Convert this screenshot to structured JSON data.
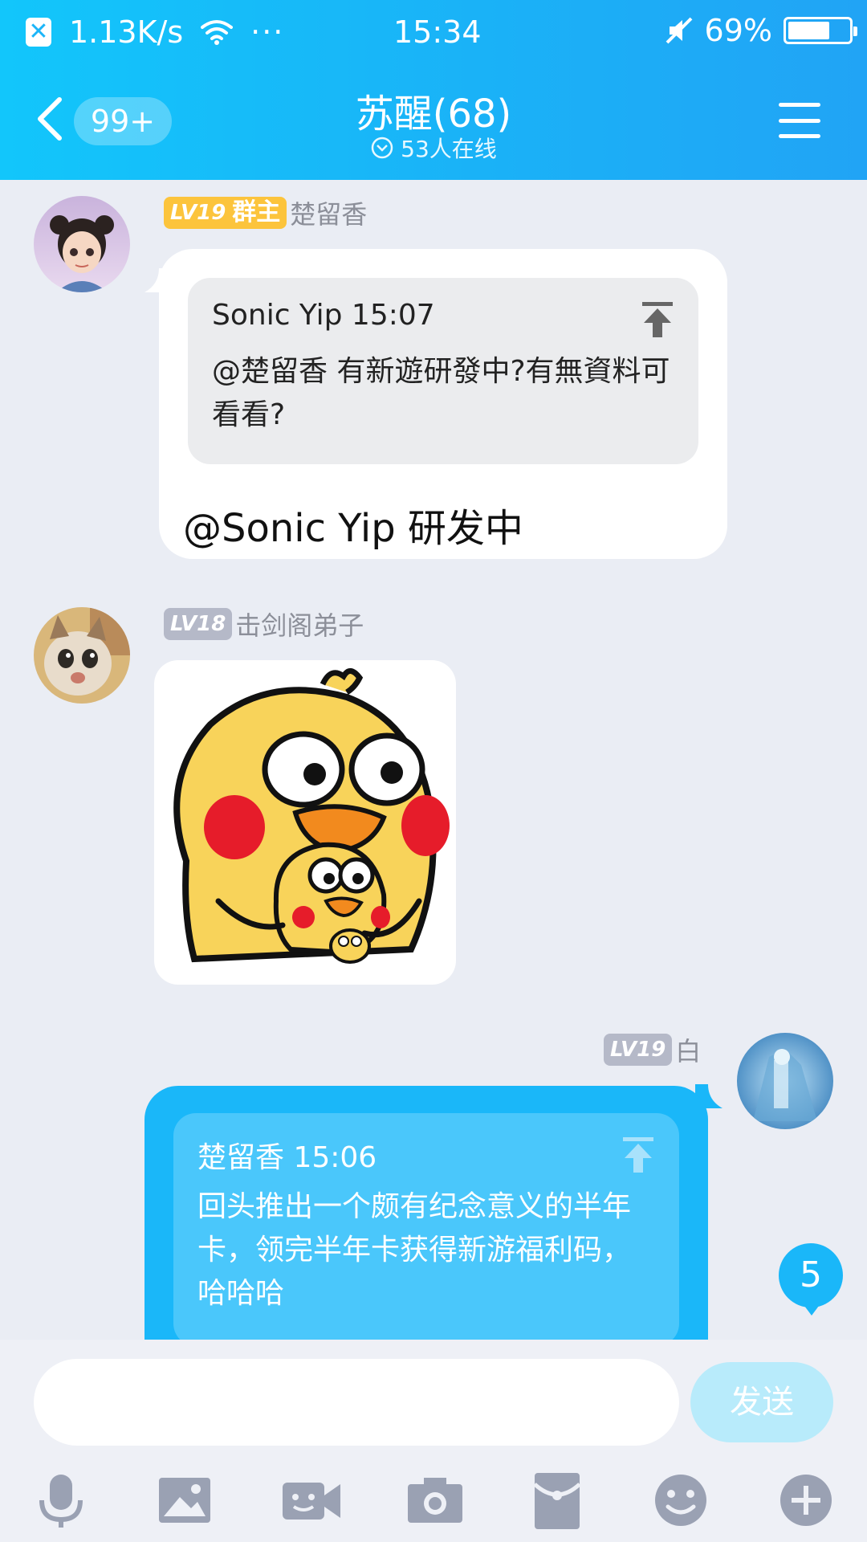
{
  "status_bar": {
    "network_speed": "1.13K/s",
    "dots": "···",
    "time": "15:34",
    "battery": "69%",
    "battery_level": 0.69,
    "icons": [
      "close-notification-icon",
      "wifi-icon",
      "mute-icon",
      "battery-icon"
    ]
  },
  "header": {
    "unread_count": "99+",
    "group_name": "苏醒(68)",
    "online_text": "53人在线",
    "icons": [
      "back-arrow-icon",
      "chevron-down-circle-icon",
      "menu-icon"
    ]
  },
  "messages": [
    {
      "level": "LV19",
      "role": "群主",
      "sender": "楚留香",
      "quote": {
        "header": "Sonic Yip 15:07",
        "text": " @楚留香 有新遊研發中?有無資料可看看?"
      },
      "text": "@Sonic Yip 研发中"
    },
    {
      "level": "LV18",
      "sender": "击剑阁弟子",
      "type": "sticker",
      "sticker": "yellow-chick-sticker"
    },
    {
      "level": "LV19",
      "sender": "白",
      "self": true,
      "quote": {
        "header": "楚留香 15:06",
        "text": "回头推出一个颇有纪念意义的半年卡，领完半年卡获得新游福利码，哈哈哈"
      }
    }
  ],
  "unread_new_messages": "5",
  "input": {
    "placeholder": "",
    "send_label": "发送"
  },
  "toolbar": [
    "microphone-icon",
    "image-icon",
    "video-call-icon",
    "camera-icon",
    "red-packet-icon",
    "emoji-icon",
    "plus-icon"
  ],
  "colors": {
    "header_start": "#12c6fb",
    "header_end": "#21a4f5",
    "self_bubble": "#1ab7f9",
    "owner_badge": "#fcc43c",
    "level_badge": "#b5b9c8",
    "chat_background": "#eaedf4"
  }
}
